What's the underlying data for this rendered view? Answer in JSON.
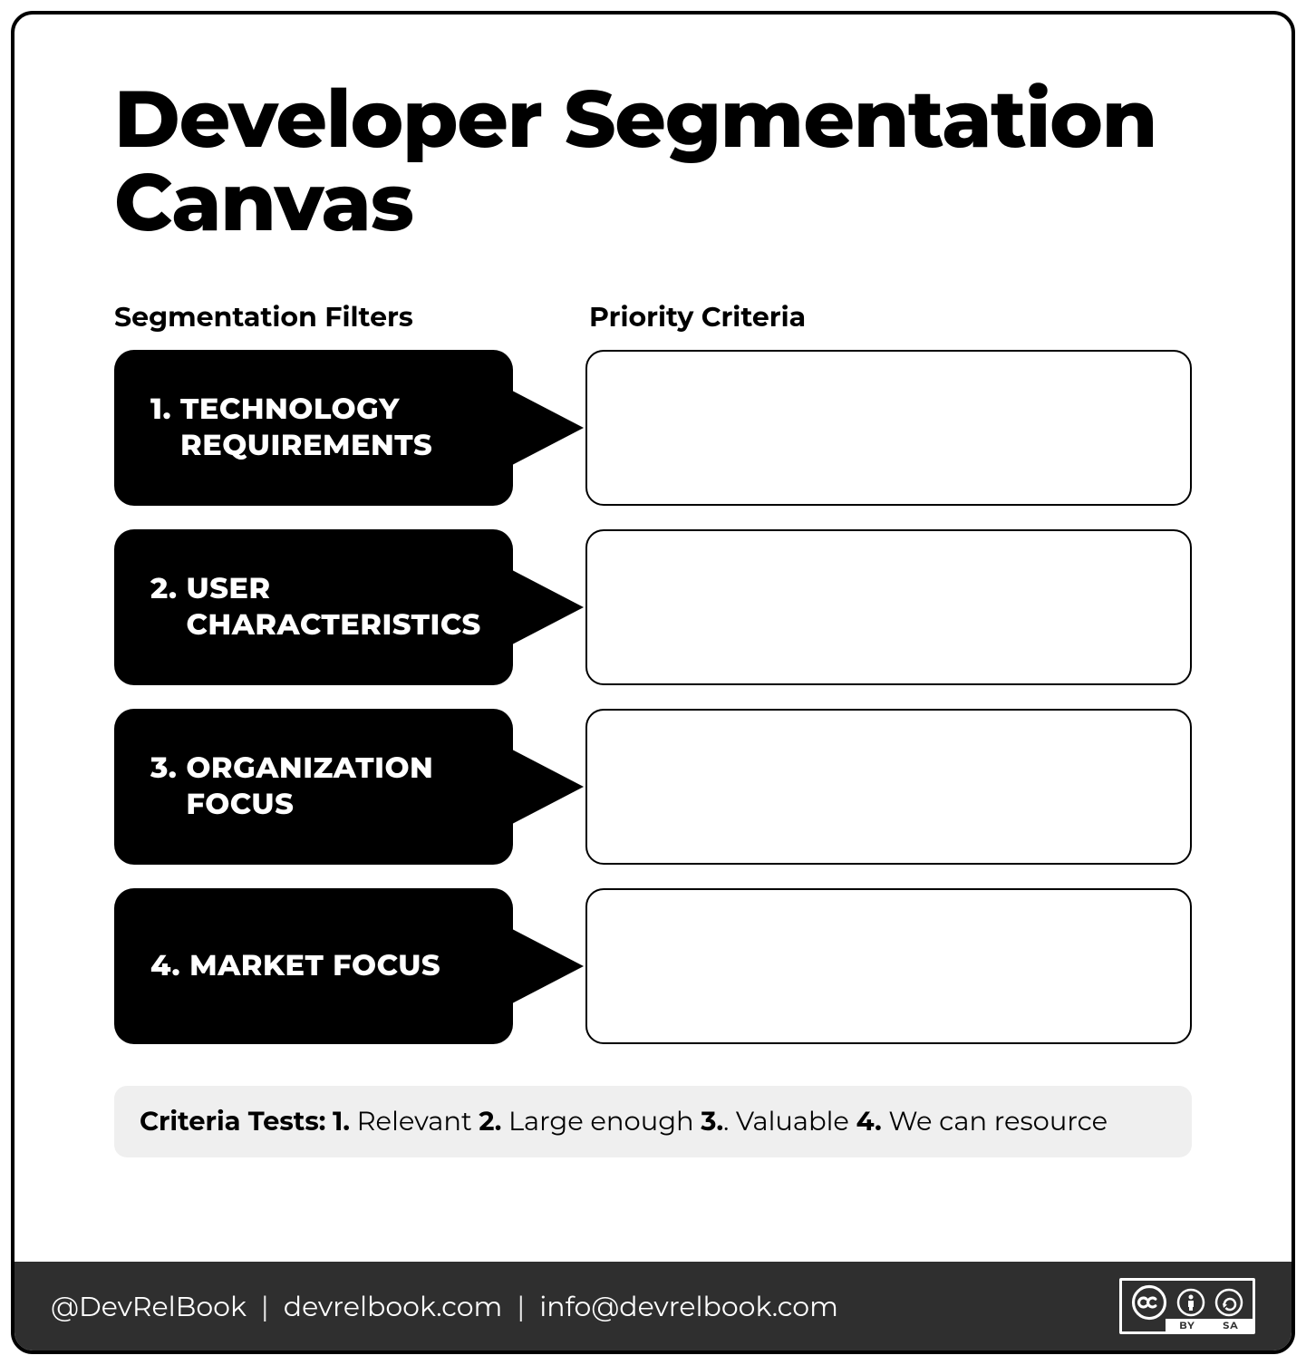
{
  "title": "Developer Segmentation Canvas",
  "headers": {
    "left": "Segmentation Filters",
    "right": "Priority Criteria"
  },
  "filters": [
    {
      "num": "1.",
      "label": "TECHNOLOGY REQUIREMENTS"
    },
    {
      "num": "2.",
      "label": "USER CHARACTERISTICS"
    },
    {
      "num": "3.",
      "label": "ORGANIZATION FOCUS"
    },
    {
      "num": "4.",
      "label": "MARKET FOCUS"
    }
  ],
  "criteria": {
    "lead": "Criteria Tests:",
    "items": [
      {
        "num": "1.",
        "text": "Relevant"
      },
      {
        "num": "2.",
        "text": "Large enough"
      },
      {
        "num": "3.",
        "text": "Valuable"
      },
      {
        "num": "4.",
        "text": "We can resource"
      }
    ]
  },
  "footer": {
    "handle": "@DevRelBook",
    "site": "devrelbook.com",
    "email": "info@devrelbook.com",
    "separator": "|",
    "cc_by": "BY",
    "cc_sa": "SA"
  }
}
